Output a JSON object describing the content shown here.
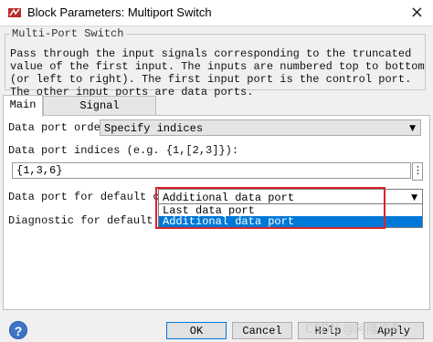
{
  "window": {
    "title": "Block Parameters: Multiport Switch",
    "close_glyph": "×"
  },
  "group": {
    "label": "Multi-Port Switch",
    "description": "Pass through the input signals corresponding to the truncated value of the first input. The inputs are numbered top to bottom (or left to right). The first input port is the control port. The other input ports are data ports."
  },
  "tabs": [
    {
      "label": "Main",
      "active": true
    },
    {
      "label": "Signal Attributes",
      "active": false
    }
  ],
  "main": {
    "data_port_order_label": "Data port order:",
    "data_port_order_value": "Specify indices",
    "data_port_indices_label": "Data port indices (e.g. {1,[2,3]}):",
    "data_port_indices_value": "{1,3,6}",
    "more_button": "⋮",
    "default_case_label": "Data port for default case:",
    "default_case_value": "Additional data port",
    "diagnostic_label": "Diagnostic for default case",
    "dropdown_options": [
      {
        "label": "Last data port",
        "selected": false
      },
      {
        "label": "Additional data port",
        "selected": true
      }
    ]
  },
  "buttons": {
    "help_icon_glyph": "?",
    "ok": "OK",
    "cancel": "Cancel",
    "help": "Help",
    "apply": "Apply"
  },
  "watermark": "CSDN @阿隆汽车",
  "colors": {
    "accent": "#0078d7",
    "highlight_border": "#d7232c",
    "help_icon": "#3d73c8"
  }
}
